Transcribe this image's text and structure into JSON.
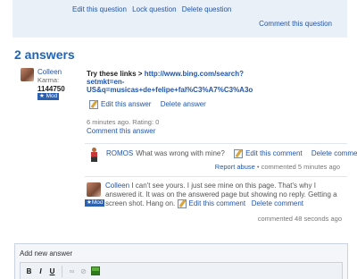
{
  "question": {
    "edit": "Edit this question",
    "lock": "Lock question",
    "delete": "Delete question",
    "comment": "Comment this question"
  },
  "answers_heading": "2 answers",
  "user": {
    "name": "Colleen",
    "karma_label": "Karma:",
    "points": "1144750",
    "badge": "★ Mod"
  },
  "answer": {
    "lead": "Try these links > ",
    "link": "http://www.bing.com/search?setmkt=en-US&q=musicas+de+felipe+fal%C3%A7%C3%A3o",
    "edit": "Edit this answer",
    "delete": "Delete answer",
    "meta": "6 minutes ago. Rating: 0",
    "comment": "Comment this answer"
  },
  "comments": [
    {
      "author": "ROMOS",
      "text": "What was wrong with mine?",
      "edit": "Edit this comment",
      "delete": "Delete comment",
      "report": "Report abuse",
      "meta": " • commented 5 minutes ago"
    },
    {
      "author": "Colleen",
      "text": " I can't see yours. I just see mine on this page. That's why I answered it. It was on the answered page but showing no reply. Getting a screen shot. Hang on.",
      "badge": "★Mod",
      "edit": "Edit this comment",
      "delete": "Delete comment",
      "meta": "commented 48 seconds ago"
    }
  ],
  "new_answer": {
    "header": "Add new answer",
    "toolbar": {
      "bold": "B",
      "italic": "I",
      "underline": "U",
      "link": "∞",
      "unlink": "⊘"
    }
  }
}
